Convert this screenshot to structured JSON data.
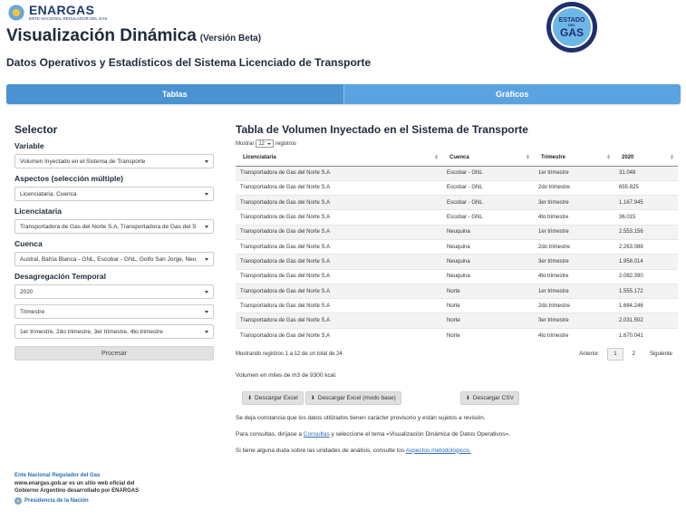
{
  "header": {
    "brand": "ENARGAS",
    "brand_sub": "ENTE NACIONAL REGULADOR DEL GAS",
    "title": "Visualización Dinámica",
    "version": "(Versión Beta)",
    "subtitle": "Datos Operativos y Estadísticos del Sistema Licenciado de Transporte",
    "seal": {
      "line1": "ESTADO",
      "line2": "DEL",
      "line3": "GAS"
    }
  },
  "tabs": [
    {
      "label": "Tablas",
      "active": true
    },
    {
      "label": "Gráficos",
      "active": false
    }
  ],
  "sidebar": {
    "title": "Selector",
    "variable_label": "Variable",
    "variable_value": "Volumen Inyectado en el Sistema de Transporte",
    "aspectos_label": "Aspectos (selección múltiple)",
    "aspectos_value": "Licenciataria, Cuenca",
    "licenciataria_label": "Licenciataria",
    "licenciataria_value": "Transportadora de Gas del Norte S.A, Transportadora de Gas del S",
    "cuenca_label": "Cuenca",
    "cuenca_value": "Austral, Bahía Blanca - GNL, Escobar - GNL, Golfo San Jorge, Neu",
    "desagregacion_label": "Desagregación Temporal",
    "year_value": "2020",
    "periodo_value": "Trimestre",
    "trimestres_value": "1er trimestre, 2do trimestre, 3er trimestre, 4to trimestre",
    "procesar_label": "Procesar"
  },
  "table": {
    "title": "Tabla de Volumen Inyectado en el Sistema de Transporte",
    "show_prefix": "Mostrar",
    "show_value": "12",
    "show_suffix": "registros",
    "columns": [
      "Licenciataria",
      "Cuenca",
      "Trimestre",
      "2020"
    ],
    "rows": [
      [
        "Transportadora de Gas del Norte S.A",
        "Escobar - GNL",
        "1er trimestre",
        "31.048"
      ],
      [
        "Transportadora de Gas del Norte S.A",
        "Escobar - GNL",
        "2do trimestre",
        "655.825"
      ],
      [
        "Transportadora de Gas del Norte S.A",
        "Escobar - GNL",
        "3er trimestre",
        "1.167.945"
      ],
      [
        "Transportadora de Gas del Norte S.A",
        "Escobar - GNL",
        "4to trimestre",
        "36.015"
      ],
      [
        "Transportadora de Gas del Norte S.A",
        "Neuquina",
        "1er trimestre",
        "2.553.156"
      ],
      [
        "Transportadora de Gas del Norte S.A",
        "Neuquina",
        "2do trimestre",
        "2.263.088"
      ],
      [
        "Transportadora de Gas del Norte S.A",
        "Neuquina",
        "3er trimestre",
        "1.958.014"
      ],
      [
        "Transportadora de Gas del Norte S.A",
        "Neuquina",
        "4to trimestre",
        "2.082.390"
      ],
      [
        "Transportadora de Gas del Norte S.A",
        "Norte",
        "1er trimestre",
        "1.555.172"
      ],
      [
        "Transportadora de Gas del Norte S.A",
        "Norte",
        "2do trimestre",
        "1.684.246"
      ],
      [
        "Transportadora de Gas del Norte S.A",
        "Norte",
        "3er trimestre",
        "2.031.502"
      ],
      [
        "Transportadora de Gas del Norte S.A",
        "Norte",
        "4to trimestre",
        "1.670.041"
      ]
    ],
    "info": "Mostrando registros 1 a 12 de un total de 24",
    "pager": {
      "prev": "Anterior",
      "pages": [
        "1",
        "2"
      ],
      "next": "Siguiente"
    }
  },
  "notes": {
    "unit": "Volumen en miles de m3 de 9300 kcal.",
    "disclaimer": "Se deja constancia que los datos utilizados tienen carácter provisorio y están sujetos a revisión.",
    "consultas_prefix": "Para consultas, diríjase a",
    "consultas_link": "Consultas",
    "consultas_suffix": "y seleccione el tema «Visualización Dinámica de Datos Operativos».",
    "aspectos_prefix": "Si tiene alguna duda sobre las unidades de análisis, consulte los",
    "aspectos_link": "Aspectos metodológicos."
  },
  "buttons": {
    "excel": "Descargar Excel",
    "excel_base": "Descargar Excel (modo base)",
    "csv": "Descargar CSV"
  },
  "footer": {
    "org": "Ente Nacional Regulador del Gas",
    "line2": "www.enargas.gob.ar es un sitio web oficial del",
    "line3": "Gobierno Argentino desarrollado por ENARGAS",
    "presidencia": "Presidencia de la Nación"
  },
  "colors": {
    "tab_bar": "#5ba3e0",
    "link": "#2a6fb5",
    "title": "#1e2b3c"
  },
  "icons": {
    "download": "download-icon",
    "caret": "chevron-down-icon",
    "sort": "sort-icon"
  }
}
